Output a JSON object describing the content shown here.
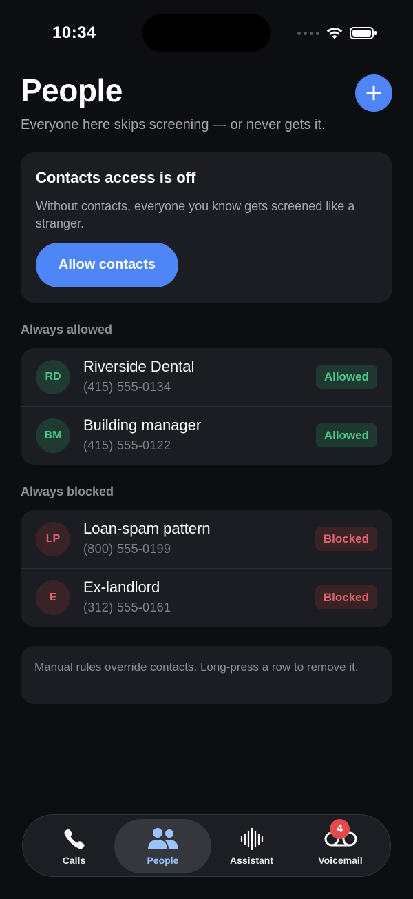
{
  "status_bar": {
    "time": "10:34"
  },
  "header": {
    "title": "People",
    "subtitle": "Everyone here skips screening — or never gets it."
  },
  "contacts_card": {
    "title": "Contacts access is off",
    "body": "Without contacts, everyone you know gets screened like a stranger.",
    "button_label": "Allow contacts"
  },
  "sections": {
    "allowed": {
      "label": "Always allowed",
      "rows": [
        {
          "initials": "RD",
          "name": "Riverside Dental",
          "phone": "(415) 555-0134",
          "status": "Allowed"
        },
        {
          "initials": "BM",
          "name": "Building manager",
          "phone": "(415) 555-0122",
          "status": "Allowed"
        }
      ]
    },
    "blocked": {
      "label": "Always blocked",
      "rows": [
        {
          "initials": "LP",
          "name": "Loan-spam pattern",
          "phone": "(800) 555-0199",
          "status": "Blocked"
        },
        {
          "initials": "E",
          "name": "Ex-landlord",
          "phone": "(312) 555-0161",
          "status": "Blocked"
        }
      ]
    }
  },
  "note": "Manual rules override contacts. Long-press a row to remove it.",
  "tabs": [
    {
      "label": "Calls",
      "icon": "phone-icon"
    },
    {
      "label": "People",
      "icon": "people-icon",
      "active": true
    },
    {
      "label": "Assistant",
      "icon": "waveform-icon"
    },
    {
      "label": "Voicemail",
      "icon": "voicemail-icon",
      "badge": "4"
    }
  ],
  "colors": {
    "accent": "#4f86f7",
    "allowed": "#4cc98a",
    "blocked": "#e0646e",
    "badge": "#e5484d"
  }
}
